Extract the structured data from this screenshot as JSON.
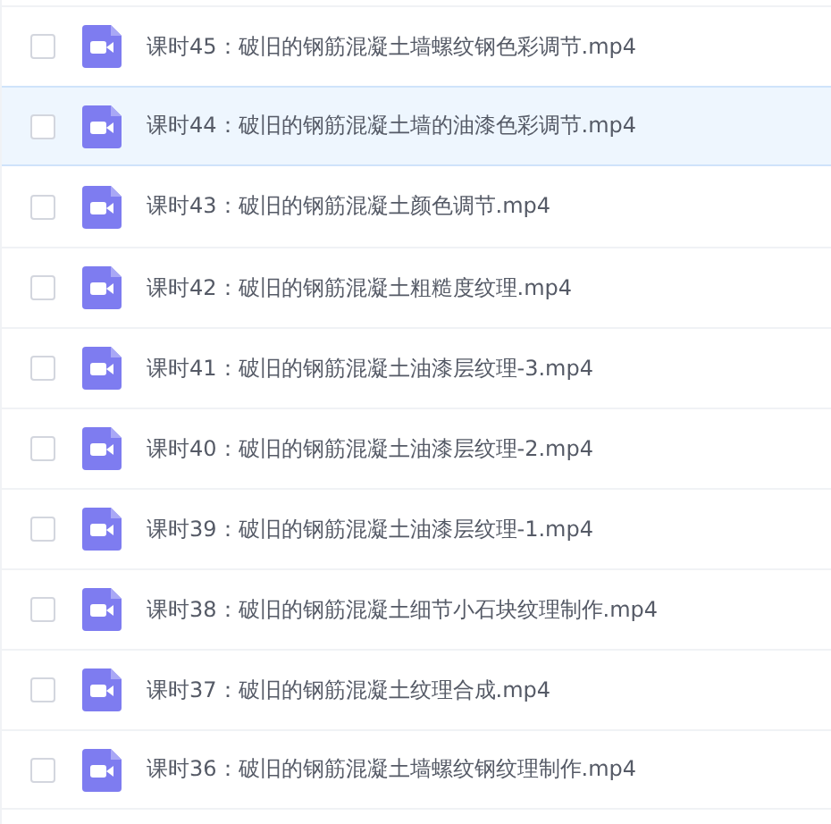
{
  "files": [
    {
      "name": "课时45：破旧的钢筋混凝土墙螺纹钢色彩调节.mp4",
      "checked": false,
      "highlighted": false
    },
    {
      "name": "课时44：破旧的钢筋混凝土墙的油漆色彩调节.mp4",
      "checked": false,
      "highlighted": true
    },
    {
      "name": "课时43：破旧的钢筋混凝土颜色调节.mp4",
      "checked": false,
      "highlighted": false
    },
    {
      "name": "课时42：破旧的钢筋混凝土粗糙度纹理.mp4",
      "checked": false,
      "highlighted": false
    },
    {
      "name": "课时41：破旧的钢筋混凝土油漆层纹理-3.mp4",
      "checked": false,
      "highlighted": false
    },
    {
      "name": "课时40：破旧的钢筋混凝土油漆层纹理-2.mp4",
      "checked": false,
      "highlighted": false
    },
    {
      "name": "课时39：破旧的钢筋混凝土油漆层纹理-1.mp4",
      "checked": false,
      "highlighted": false
    },
    {
      "name": "课时38：破旧的钢筋混凝土细节小石块纹理制作.mp4",
      "checked": false,
      "highlighted": false
    },
    {
      "name": "课时37：破旧的钢筋混凝土纹理合成.mp4",
      "checked": false,
      "highlighted": false
    },
    {
      "name": "课时36：破旧的钢筋混凝土墙螺纹钢纹理制作.mp4",
      "checked": false,
      "highlighted": false
    }
  ]
}
